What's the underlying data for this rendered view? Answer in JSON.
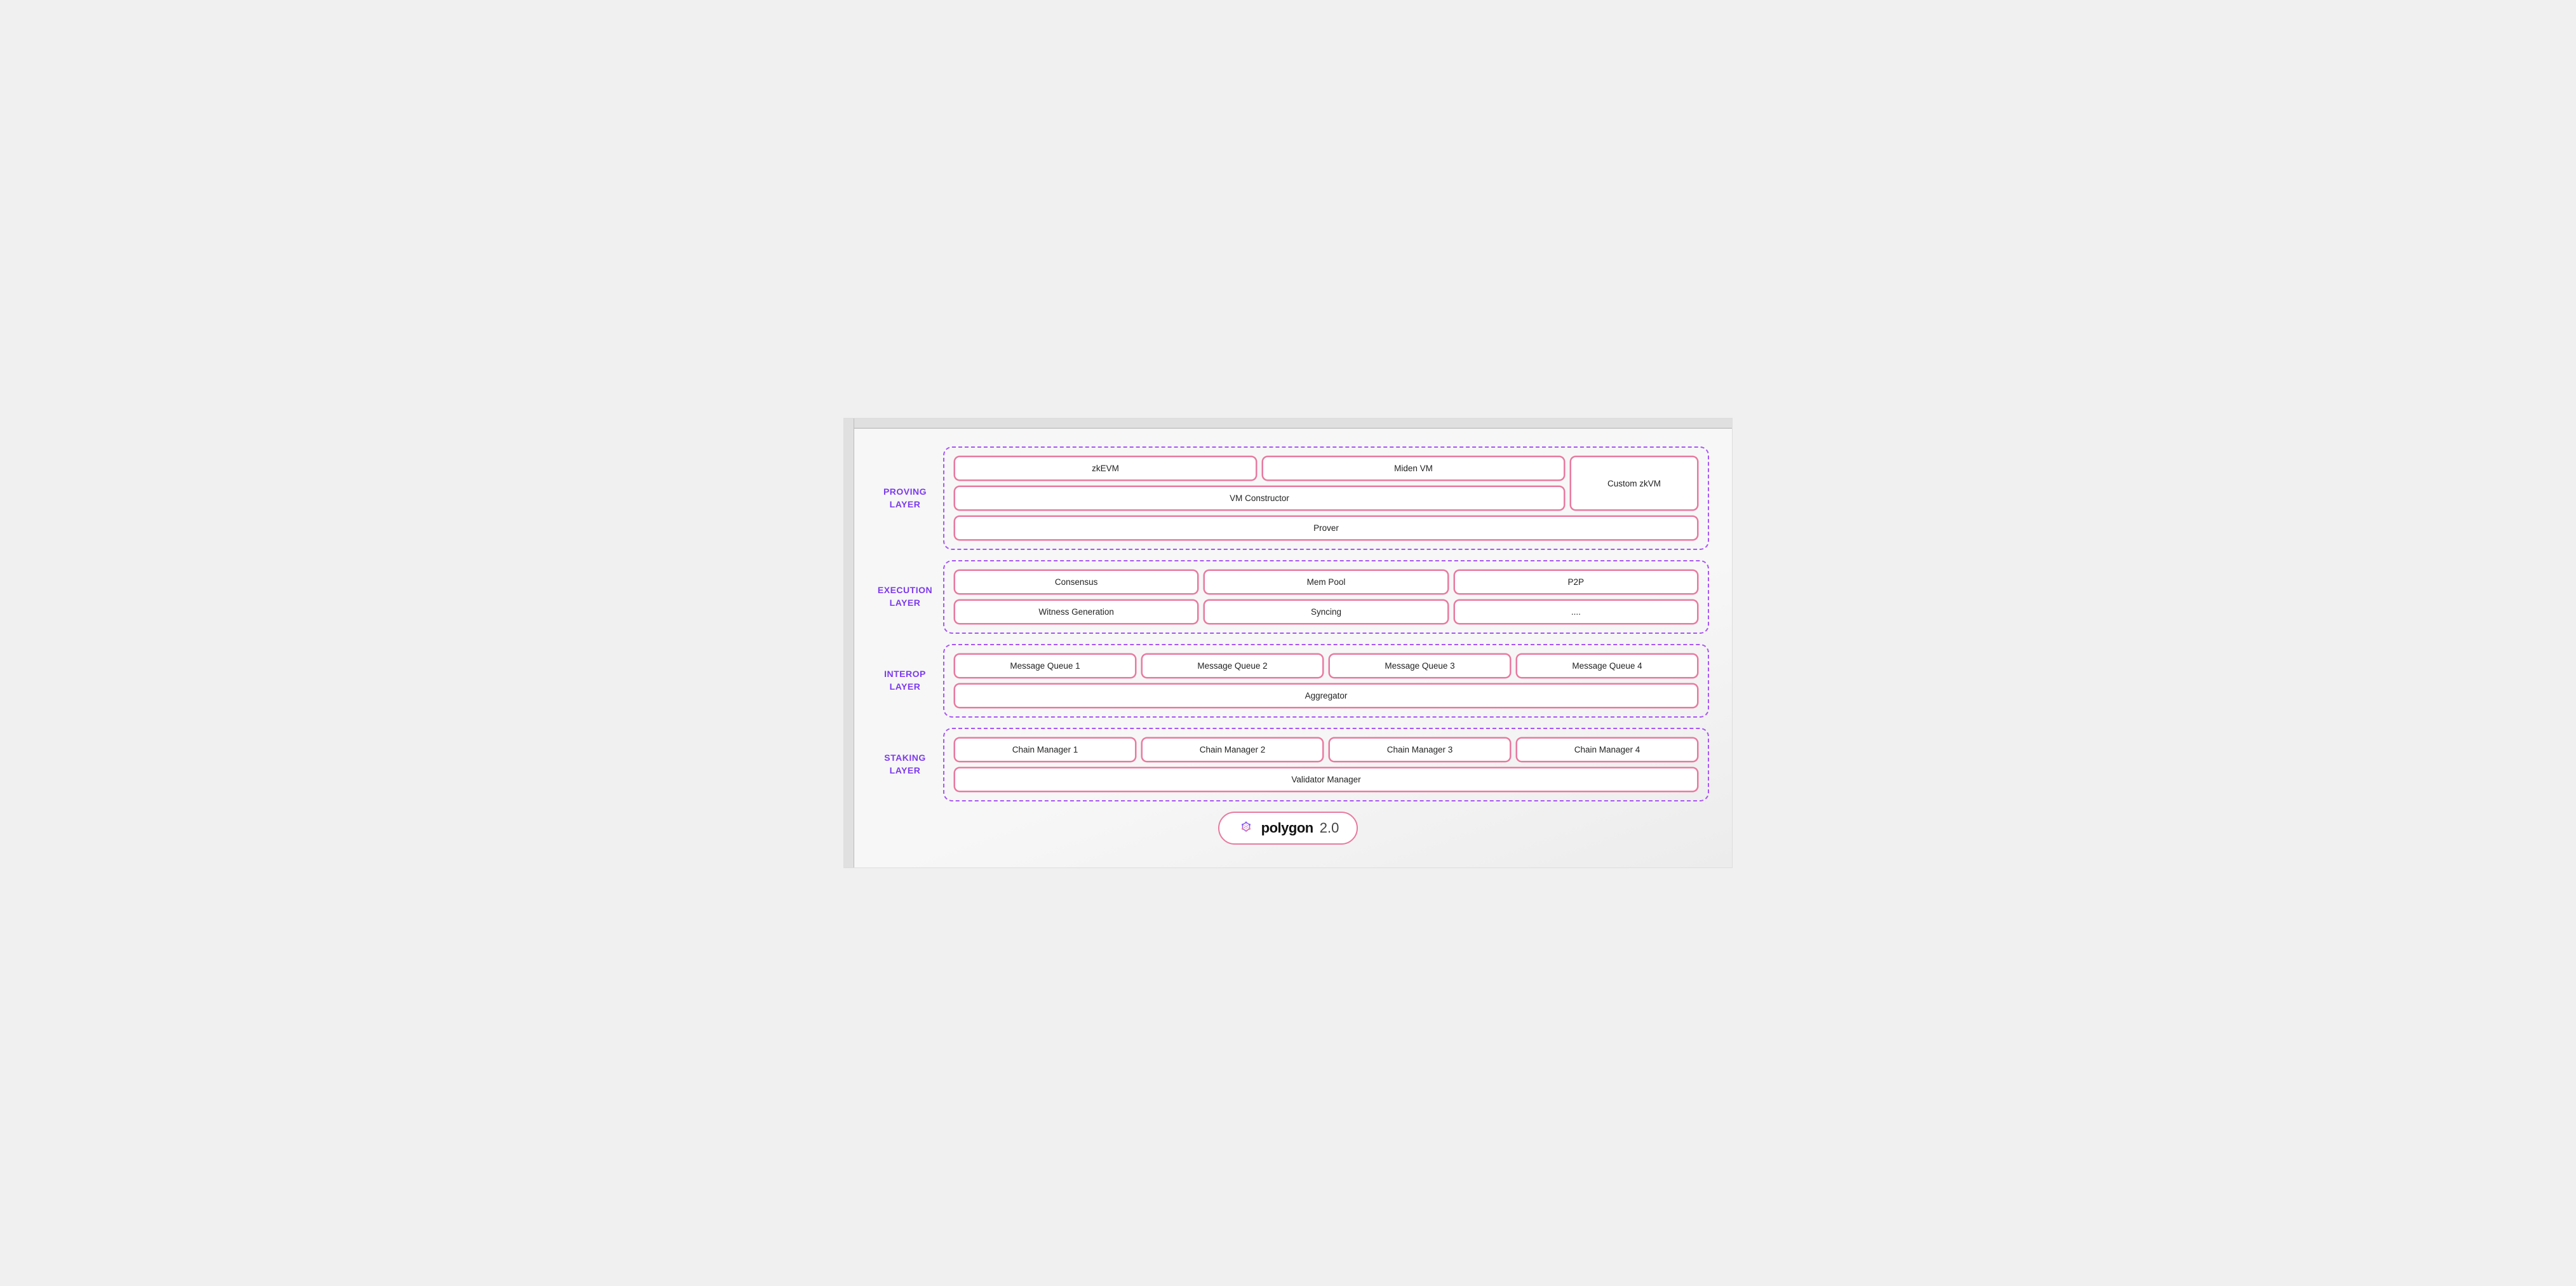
{
  "layers": [
    {
      "id": "proving",
      "label": "PROVING\nLAYER",
      "rows": [
        {
          "components": [
            {
              "label": "zkEVM"
            },
            {
              "label": "Miden VM"
            }
          ],
          "right_component": {
            "label": "Custom zkVM",
            "rowspan": true
          }
        },
        {
          "components": [
            {
              "label": "VM Constructor",
              "full": true
            }
          ]
        },
        {
          "components": [
            {
              "label": "Prover",
              "full": true
            }
          ]
        }
      ]
    },
    {
      "id": "execution",
      "label": "EXECUTION\nLAYER",
      "rows": [
        {
          "components": [
            {
              "label": "Consensus"
            },
            {
              "label": "Mem Pool"
            },
            {
              "label": "P2P"
            }
          ]
        },
        {
          "components": [
            {
              "label": "Witness Generation"
            },
            {
              "label": "Syncing"
            },
            {
              "label": "...."
            }
          ]
        }
      ]
    },
    {
      "id": "interop",
      "label": "INTEROP\nLAYER",
      "rows": [
        {
          "components": [
            {
              "label": "Message Queue 1"
            },
            {
              "label": "Message Queue 2"
            },
            {
              "label": "Message Queue 3"
            },
            {
              "label": "Message Queue 4"
            }
          ]
        },
        {
          "components": [
            {
              "label": "Aggregator",
              "full": true
            }
          ]
        }
      ]
    },
    {
      "id": "staking",
      "label": "STAKING\nLAYER",
      "rows": [
        {
          "components": [
            {
              "label": "Chain Manager 1"
            },
            {
              "label": "Chain Manager 2"
            },
            {
              "label": "Chain Manager 3"
            },
            {
              "label": "Chain Manager 4"
            }
          ]
        },
        {
          "components": [
            {
              "label": "Validator Manager",
              "full": true
            }
          ]
        }
      ]
    }
  ],
  "polygon": {
    "text": "polygon",
    "version": "2.0",
    "logo_color": "#8b5cf6"
  }
}
